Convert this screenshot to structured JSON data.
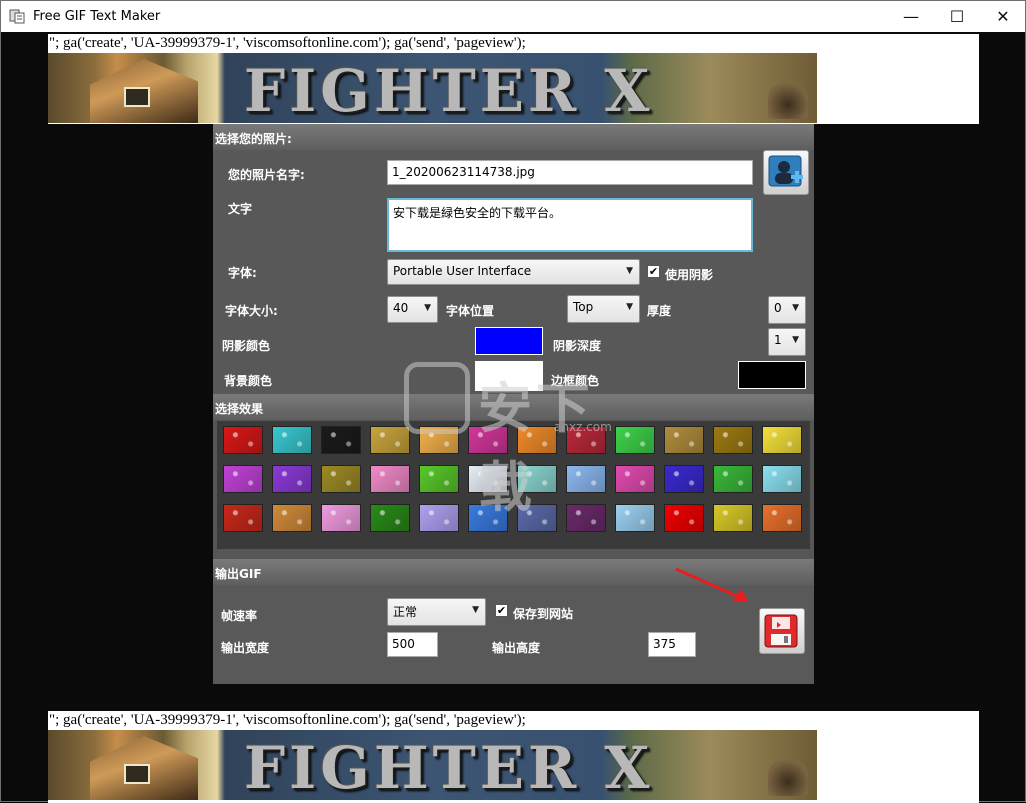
{
  "window": {
    "title": "Free GIF Text Maker",
    "controls": {
      "minimize": "—",
      "maximize": "☐",
      "close": "✕"
    }
  },
  "web_embed": {
    "script_text": "\"; ga('create', 'UA-39999379-1', 'viscomsoftonline.com'); ga('send', 'pageview');",
    "banner_text": "FIGHTER X"
  },
  "photo_section": {
    "header": "选择您的照片:",
    "photo_name_label": "您的照片名字:",
    "photo_name_value": "1_20200623114738.jpg",
    "text_label": "文字",
    "text_value": "安下载是緑色安全的下载平台。",
    "font_label": "字体:",
    "font_value": "Portable User Interface",
    "use_shadow_label": "使用阴影",
    "use_shadow_checked": "✔",
    "font_size_label": "字体大小:",
    "font_size_value": "40",
    "font_position_label": "字体位置",
    "font_position_value": "Top",
    "thickness_label": "厚度",
    "thickness_value": "0",
    "shadow_color_label": "阴影颜色",
    "shadow_color": "#0000ff",
    "shadow_depth_label": "阴影深度",
    "shadow_depth_value": "1",
    "bg_color_label": "背景颜色",
    "bg_color": "#ffffff",
    "border_color_label": "边框颜色",
    "border_color": "#000000"
  },
  "effects_section": {
    "header": "选择效果",
    "effects": [
      {
        "name": "red-sparkle",
        "color": "#d81818"
      },
      {
        "name": "cyan-glitter",
        "color": "#39c7cf"
      },
      {
        "name": "black-stars",
        "color": "#1b1b1b"
      },
      {
        "name": "gold-glitter",
        "color": "#c7a43c"
      },
      {
        "name": "orange-flare",
        "color": "#f0b04a"
      },
      {
        "name": "pink-stars",
        "color": "#d2369a"
      },
      {
        "name": "orange-stars",
        "color": "#ef8a2a"
      },
      {
        "name": "usa-flag",
        "color": "#b9293a"
      },
      {
        "name": "green-glitter",
        "color": "#3fd24a"
      },
      {
        "name": "bronze-glitter",
        "color": "#b08d3c"
      },
      {
        "name": "gold-bar",
        "color": "#9c7a12"
      },
      {
        "name": "yellow-shine",
        "color": "#f3e03a"
      },
      {
        "name": "magenta-stars",
        "color": "#c042d6"
      },
      {
        "name": "purple-sparkle",
        "color": "#8a3ad6"
      },
      {
        "name": "olive-glitter",
        "color": "#9c8a26"
      },
      {
        "name": "pink-dots",
        "color": "#f08ac8"
      },
      {
        "name": "green-splash",
        "color": "#58c82a"
      },
      {
        "name": "snow-dots",
        "color": "#e4ecf6"
      },
      {
        "name": "teal-swirl",
        "color": "#8ad6d0"
      },
      {
        "name": "blue-waves",
        "color": "#8cb8f0"
      },
      {
        "name": "rainbow-burst",
        "color": "#e04ab0"
      },
      {
        "name": "blue-night-stars",
        "color": "#3a2ad0"
      },
      {
        "name": "green-tiles",
        "color": "#3ab83a"
      },
      {
        "name": "aqua-rays",
        "color": "#8ae0f0"
      },
      {
        "name": "fire-sparkle",
        "color": "#c8281a"
      },
      {
        "name": "orange-stones",
        "color": "#d08a3a"
      },
      {
        "name": "pink-tiles",
        "color": "#f09ae0"
      },
      {
        "name": "green-gradient",
        "color": "#2a8a1a"
      },
      {
        "name": "lavender-glow",
        "color": "#b0a0f0"
      },
      {
        "name": "blue-glitter",
        "color": "#3a7ae0"
      },
      {
        "name": "silver-sparkle",
        "color": "#5a6aa8"
      },
      {
        "name": "plum-sparkle",
        "color": "#6a2a6a"
      },
      {
        "name": "pastel-dots",
        "color": "#9ad0f0"
      },
      {
        "name": "solid-red",
        "color": "#f00000"
      },
      {
        "name": "yellow-glitter",
        "color": "#d8c828"
      },
      {
        "name": "orange-rays",
        "color": "#e8702a"
      }
    ]
  },
  "output_section": {
    "header": "输出GIF",
    "frame_rate_label": "帧速率",
    "frame_rate_value": "正常",
    "save_to_site_label": "保存到网站",
    "save_to_site_checked": "✔",
    "width_label": "输出宽度",
    "width_value": "500",
    "height_label": "输出高度",
    "height_value": "375"
  },
  "watermark": {
    "text": "安下载",
    "sub": "anxz.com"
  },
  "colors": {
    "panel": "#565656",
    "accent_arrow": "#e81e1e"
  }
}
